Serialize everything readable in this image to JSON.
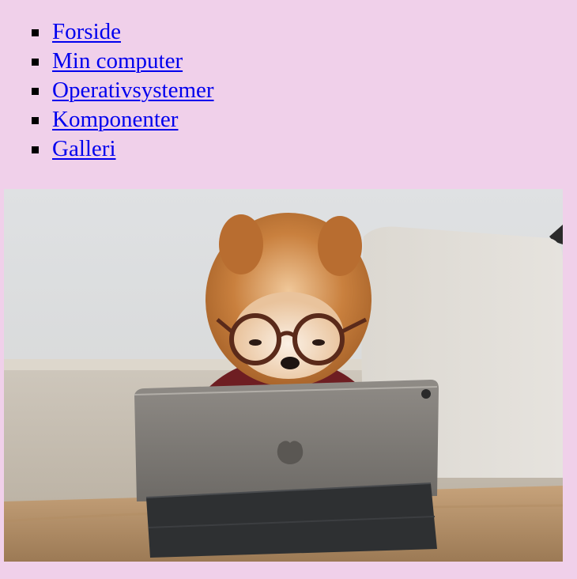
{
  "nav": {
    "items": [
      {
        "label": "Forside"
      },
      {
        "label": "Min computer"
      },
      {
        "label": "Operativsystemer"
      },
      {
        "label": "Komponenter"
      },
      {
        "label": "Galleri"
      }
    ]
  },
  "colors": {
    "page_background": "#f0d0ea",
    "link": "#0000ee"
  }
}
